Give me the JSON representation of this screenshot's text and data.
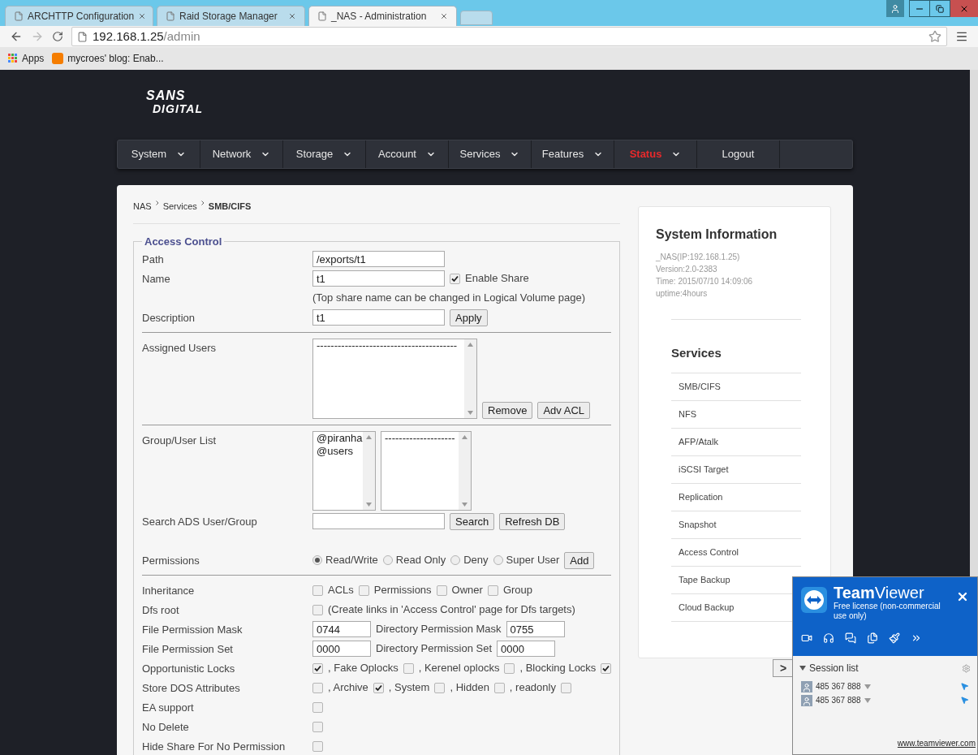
{
  "browser": {
    "tabs": [
      {
        "title": "ARCHTTP Configuration",
        "selected": false
      },
      {
        "title": "Raid Storage Manager",
        "selected": false
      },
      {
        "title": "_NAS - Administration",
        "selected": true
      }
    ],
    "url_host": "192.168.1.25",
    "url_path": "/admin",
    "bookmarks": [
      "Apps",
      "mycroes' blog: Enab..."
    ]
  },
  "logo": [
    "SANS",
    "DIGITAL"
  ],
  "nav": [
    {
      "label": "System",
      "has_menu": true,
      "active": false
    },
    {
      "label": "Network",
      "has_menu": true,
      "active": false
    },
    {
      "label": "Storage",
      "has_menu": true,
      "active": false
    },
    {
      "label": "Account",
      "has_menu": true,
      "active": false
    },
    {
      "label": "Services",
      "has_menu": true,
      "active": false
    },
    {
      "label": "Features",
      "has_menu": true,
      "active": false
    },
    {
      "label": "Status",
      "has_menu": true,
      "active": true
    },
    {
      "label": "Logout",
      "has_menu": false,
      "active": false
    }
  ],
  "breadcrumb": [
    "NAS",
    "Services",
    "SMB/CIFS"
  ],
  "form": {
    "legend": "Access Control",
    "rows": [
      {
        "kind": "row",
        "label": "Path",
        "controls": [
          {
            "kind": "input",
            "value": "/exports/t1"
          }
        ]
      },
      {
        "kind": "row",
        "label": "Name",
        "controls": [
          {
            "kind": "input",
            "value": "t1"
          },
          {
            "kind": "check",
            "checked": true
          },
          {
            "kind": "text",
            "text": "Enable Share"
          }
        ]
      },
      {
        "kind": "row",
        "controls": [
          {
            "kind": "text",
            "text": "(Top share name can be changed in Logical Volume page)"
          }
        ]
      },
      {
        "kind": "row",
        "label": "Description",
        "controls": [
          {
            "kind": "input",
            "value": "t1"
          },
          {
            "kind": "button",
            "text": "Apply"
          }
        ]
      },
      {
        "kind": "divider"
      },
      {
        "kind": "row",
        "label": "Assigned Users",
        "controls": [
          {
            "kind": "listbox",
            "items": [
              "----------------------------------------"
            ]
          },
          {
            "kind": "button",
            "text": "Remove"
          },
          {
            "kind": "button",
            "text": "Adv ACL"
          }
        ]
      },
      {
        "kind": "divider"
      },
      {
        "kind": "row",
        "label": "Group/User List",
        "controls": [
          {
            "kind": "small_listbox",
            "items": [
              "@piranha",
              "@users"
            ]
          },
          {
            "kind": "medium_listbox",
            "items": [
              "--------------------"
            ]
          }
        ]
      },
      {
        "kind": "row",
        "label": "Search ADS User/Group",
        "controls": [
          {
            "kind": "input"
          },
          {
            "kind": "button",
            "text": "Search"
          },
          {
            "kind": "button",
            "text": "Refresh DB"
          }
        ]
      },
      {
        "kind": "gap"
      },
      {
        "kind": "row",
        "label": "Permissions",
        "controls": [
          {
            "kind": "radio",
            "selected": true,
            "text": "Read/Write"
          },
          {
            "kind": "radio",
            "selected": false,
            "text": "Read Only"
          },
          {
            "kind": "radio",
            "selected": false,
            "text": "Deny"
          },
          {
            "kind": "radio",
            "selected": false,
            "text": "Super User"
          },
          {
            "kind": "button",
            "text": "Add"
          }
        ]
      },
      {
        "kind": "divider"
      },
      {
        "kind": "row",
        "label": "Inheritance",
        "controls": [
          {
            "kind": "check",
            "checked": false
          },
          {
            "kind": "text",
            "text": "ACLs"
          },
          {
            "kind": "check",
            "checked": false
          },
          {
            "kind": "text",
            "text": "Permissions"
          },
          {
            "kind": "check",
            "checked": false
          },
          {
            "kind": "text",
            "text": "Owner"
          },
          {
            "kind": "check",
            "checked": false
          },
          {
            "kind": "text",
            "text": "Group"
          }
        ]
      },
      {
        "kind": "row",
        "label": "Dfs root",
        "controls": [
          {
            "kind": "check",
            "checked": false
          },
          {
            "kind": "text",
            "text": "(Create links in 'Access Control' page for Dfs targets)"
          }
        ]
      },
      {
        "kind": "row",
        "label": "File Permission Mask",
        "controls": [
          {
            "kind": "short_input",
            "value": "0744"
          },
          {
            "kind": "text",
            "text": "Directory Permission Mask"
          },
          {
            "kind": "short_input",
            "value": "0755"
          }
        ]
      },
      {
        "kind": "row",
        "label": "File Permission Set",
        "controls": [
          {
            "kind": "short_input",
            "value": "0000"
          },
          {
            "kind": "text",
            "text": "Directory Permission Set"
          },
          {
            "kind": "short_input",
            "value": "0000"
          }
        ]
      },
      {
        "kind": "row",
        "label": "Opportunistic Locks",
        "controls": [
          {
            "kind": "check",
            "checked": true
          },
          {
            "kind": "text",
            "text": ", Fake Oplocks"
          },
          {
            "kind": "check",
            "checked": false
          },
          {
            "kind": "text",
            "text": ", Kerenel oplocks"
          },
          {
            "kind": "check",
            "checked": false
          },
          {
            "kind": "text",
            "text": ", Blocking Locks"
          },
          {
            "kind": "check",
            "checked": true
          }
        ]
      },
      {
        "kind": "row",
        "label": "Store DOS Attributes",
        "controls": [
          {
            "kind": "check",
            "checked": false
          },
          {
            "kind": "text",
            "text": ", Archive"
          },
          {
            "kind": "check",
            "checked": true
          },
          {
            "kind": "text",
            "text": ", System"
          },
          {
            "kind": "check",
            "checked": false
          },
          {
            "kind": "text",
            "text": ", Hidden"
          },
          {
            "kind": "check",
            "checked": false
          },
          {
            "kind": "text",
            "text": ", readonly"
          },
          {
            "kind": "check",
            "checked": false
          }
        ]
      },
      {
        "kind": "row",
        "label": "EA support",
        "controls": [
          {
            "kind": "check",
            "checked": false
          }
        ]
      },
      {
        "kind": "row",
        "label": "No Delete",
        "controls": [
          {
            "kind": "check",
            "checked": false
          }
        ]
      },
      {
        "kind": "row",
        "label": "Hide Share For No Permission",
        "controls": [
          {
            "kind": "check",
            "checked": false
          }
        ]
      }
    ]
  },
  "sidebar": {
    "title": "System Information",
    "info": [
      "_NAS(IP:192.168.1.25)",
      "Version:2.0-2383",
      "Time: 2015/07/10 14:09:06",
      "uptime:4hours"
    ],
    "services_title": "Services",
    "services": [
      "SMB/CIFS",
      "NFS",
      "AFP/Atalk",
      "iSCSI Target",
      "Replication",
      "Snapshot",
      "Access Control",
      "Tape Backup",
      "Cloud Backup"
    ]
  },
  "teamviewer": {
    "title": "**Team**Viewer",
    "license": "Free license (non-commercial use only)",
    "toggle": ">",
    "session_list": "Session list",
    "sessions": [
      "485 367 888",
      "485 367 888"
    ],
    "link": "www.teamviewer.com"
  }
}
